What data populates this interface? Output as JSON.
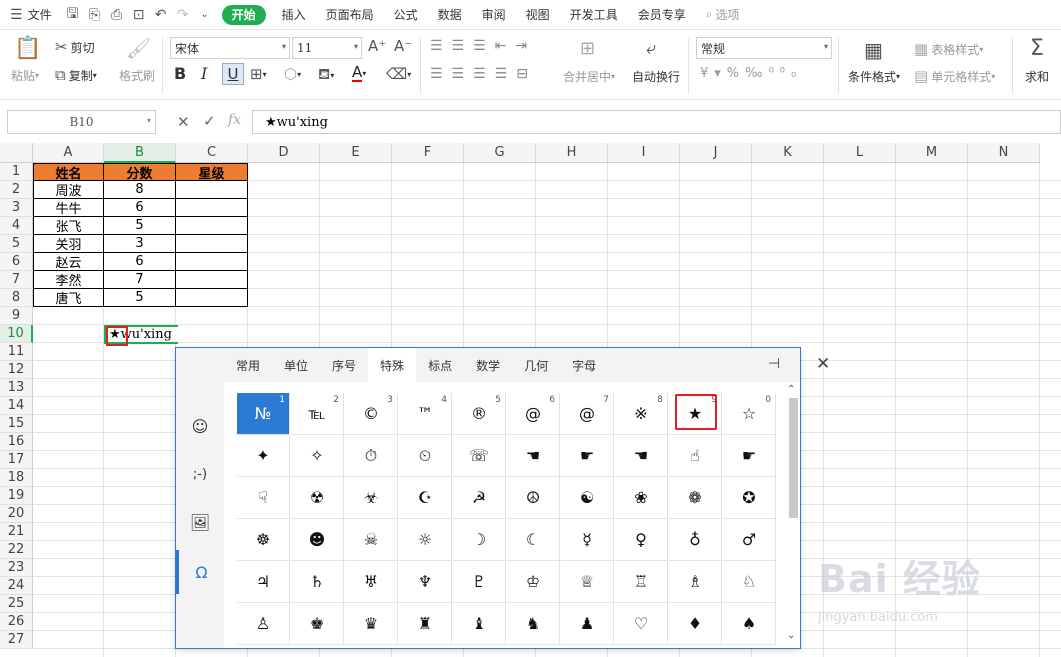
{
  "menubar": {
    "file": "文件",
    "tabs": [
      "开始",
      "插入",
      "页面布局",
      "公式",
      "数据",
      "审阅",
      "视图",
      "开发工具",
      "会员专享"
    ],
    "search": "选项"
  },
  "ribbon": {
    "paste": "粘贴",
    "cut": "剪切",
    "copy": "复制",
    "format_painter": "格式刷",
    "font_name": "宋体",
    "font_size": "11",
    "merge": "合并居中",
    "wrap": "自动换行",
    "number_format": "常规",
    "cond_format": "条件格式",
    "table_style": "表格样式",
    "cell_style": "单元格样式",
    "sum": "求和"
  },
  "formula_bar": {
    "name_box": "B10",
    "fx": "fx",
    "content": "★wu'xing"
  },
  "sheet": {
    "columns": [
      "A",
      "B",
      "C",
      "D",
      "E",
      "F",
      "G",
      "H",
      "I",
      "J",
      "K",
      "L",
      "M",
      "N"
    ],
    "rows": [
      "1",
      "2",
      "3",
      "4",
      "5",
      "6",
      "7",
      "8",
      "9",
      "10",
      "11",
      "12",
      "13",
      "14",
      "15",
      "16",
      "17",
      "18",
      "19",
      "20",
      "21",
      "22",
      "23",
      "24",
      "25",
      "26",
      "27"
    ],
    "headers": [
      "姓名",
      "分数",
      "星级"
    ],
    "data": [
      [
        "周波",
        "8"
      ],
      [
        "牛牛",
        "6"
      ],
      [
        "张飞",
        "5"
      ],
      [
        "关羽",
        "3"
      ],
      [
        "赵云",
        "6"
      ],
      [
        "李然",
        "7"
      ],
      [
        "唐飞",
        "5"
      ]
    ],
    "b10": "★wu'xing"
  },
  "symbol_panel": {
    "tabs": [
      "常用",
      "单位",
      "序号",
      "特殊",
      "标点",
      "数学",
      "几何",
      "字母"
    ],
    "side": [
      "☺",
      ";-)",
      "🖼",
      "Ω"
    ],
    "row1": [
      [
        "№",
        "1"
      ],
      [
        "℡",
        "2"
      ],
      [
        "©",
        "3"
      ],
      [
        "™",
        "4"
      ],
      [
        "®",
        "5"
      ],
      [
        "@",
        "6"
      ],
      [
        "@",
        "7"
      ],
      [
        "※",
        "8"
      ],
      [
        "★",
        "9"
      ],
      [
        "☆",
        "0"
      ]
    ],
    "row2": [
      "✦",
      "✧",
      "⏱",
      "⏲",
      "☏",
      "☚",
      "☛",
      "☚",
      "☝",
      "☛"
    ],
    "row3": [
      "☟",
      "☢",
      "☣",
      "☪",
      "☭",
      "☮",
      "☯",
      "❀",
      "❁",
      "✪"
    ],
    "row4": [
      "☸",
      "☻",
      "☠",
      "☼",
      "☽",
      "☾",
      "☿",
      "♀",
      "♁",
      "♂"
    ],
    "row5": [
      "♃",
      "♄",
      "♅",
      "♆",
      "♇",
      "♔",
      "♕",
      "♖",
      "♗",
      "♘"
    ],
    "row6": [
      "♙",
      "♚",
      "♛",
      "♜",
      "♝",
      "♞",
      "♟",
      "♡",
      "♦",
      "♠"
    ]
  },
  "watermark": {
    "brand": "Bai 经验",
    "url": "jingyan.baidu.com"
  }
}
